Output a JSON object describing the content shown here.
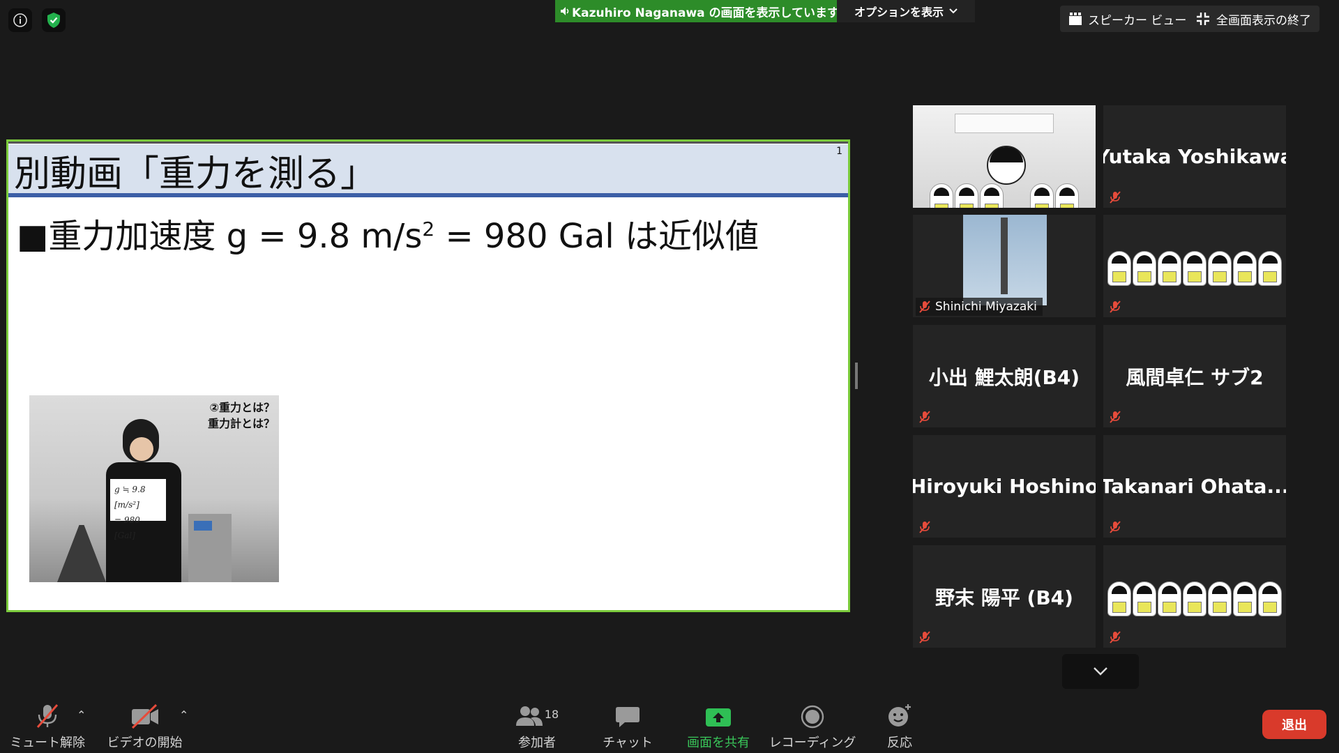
{
  "top": {
    "share_banner": "Kazuhiro  Naganawa の画面を表示しています",
    "options_label": "オプションを表示",
    "speaker_view_label": "スピーカー ビュー",
    "exit_fullscreen_label": "全画面表示の終了"
  },
  "slide": {
    "title": "別動画「重力を測る」",
    "page_number": "1",
    "bullet_prefix": "■重力加速度 g = 9.8 m/s",
    "bullet_exponent": "2",
    "bullet_suffix": " = 980 Gal は近似値",
    "video_caption_line1": "②重力とは？",
    "video_caption_line2": "重力計とは？",
    "card_line1": "g ≒ 9.8 [m/s²]",
    "card_line2": "= 980 [Gal]"
  },
  "gallery": {
    "tiles": [
      {
        "name": ""
      },
      {
        "name": "Yutaka Yoshikawa"
      },
      {
        "name": "Shinichi Miyazaki"
      },
      {
        "name": ""
      },
      {
        "name": "小出 鯉太朗(B4)"
      },
      {
        "name": "風間卓仁 サブ2"
      },
      {
        "name": "Hiroyuki Hoshino"
      },
      {
        "name": "Takanari  Ohata..."
      },
      {
        "name": "野末 陽平 (B4)"
      },
      {
        "name": ""
      }
    ]
  },
  "toolbar": {
    "unmute_label": "ミュート解除",
    "start_video_label": "ビデオの開始",
    "participants_label": "参加者",
    "participants_count": "18",
    "chat_label": "チャット",
    "share_label": "画面を共有",
    "record_label": "レコーディング",
    "reactions_label": "反応",
    "leave_label": "退出"
  },
  "colors": {
    "share_green": "#2d8c29",
    "slide_border": "#7ccc3c",
    "slide_header_bg": "#d8e1ee",
    "slide_rule": "#3b5ea6",
    "leave_red": "#d93a2b"
  }
}
